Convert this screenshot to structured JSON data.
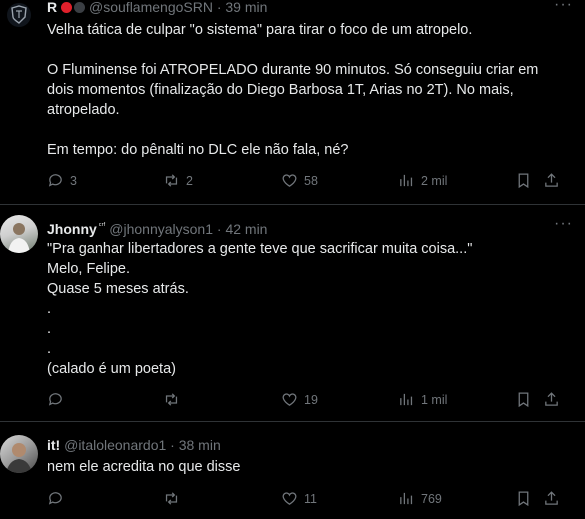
{
  "posts": [
    {
      "name": "R",
      "handle": "@souflamengoSRN",
      "time": "· 39 min",
      "text": "Velha tática de culpar \"o sistema\" para tirar o foco de um atropelo.\n\nO Fluminense foi ATROPELADO durante 90 minutos. Só conseguiu criar em dois momentos (finalização do Diego Barbosa 1T, Arias no 2T). No mais, atropelado.\n\nEm tempo: do pênalti no DLC ele não fala, né?",
      "replies": "3",
      "reposts": "2",
      "likes": "58",
      "views": "2 mil"
    },
    {
      "name": "Jhonny",
      "badge": "ᶜʳᶠ",
      "handle": "@jhonnyalyson1",
      "time": "· 42 min",
      "text": "\"Pra ganhar libertadores a gente teve que sacrificar muita coisa...\"\nMelo, Felipe.\nQuase 5 meses atrás.\n.\n.\n.\n(calado é um poeta)",
      "replies": "",
      "reposts": "",
      "likes": "19",
      "views": "1 mil"
    },
    {
      "name": "it!",
      "handle": "@italoleonardo1",
      "time": "· 38 min",
      "text": "nem ele acredita no que disse",
      "replies": "",
      "reposts": "",
      "likes": "11",
      "views": "769"
    }
  ],
  "more_glyph": "···",
  "colors": {
    "muted": "#71767b",
    "text": "#e7e9ea",
    "separator": "#2f3336",
    "background": "#000000"
  },
  "icons": [
    "reply-icon",
    "repost-icon",
    "like-icon",
    "views-icon",
    "bookmark-icon",
    "share-icon",
    "more-icon"
  ]
}
